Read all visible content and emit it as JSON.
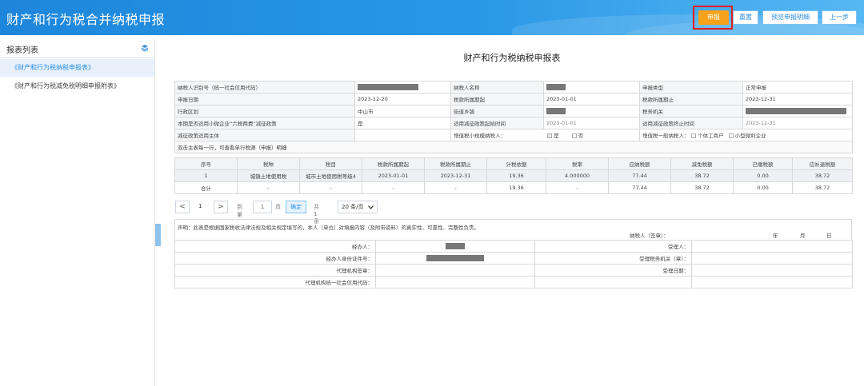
{
  "header": {
    "title": "财产和行为税合并纳税申报",
    "buttons": {
      "declare": "申报",
      "reset": "重置",
      "preview": "预览申报明细",
      "prev": "上一步"
    }
  },
  "sidebar": {
    "title": "报表列表",
    "items": [
      {
        "label": "《财产和行为税纳税申报表》"
      },
      {
        "label": "《财产和行为税减免税明细申报附表》"
      }
    ]
  },
  "form": {
    "title": "财产和行为税纳税申报表",
    "rows": [
      [
        "纳税人识别号（统一社会信用代码）",
        "",
        "纳税人名称",
        "",
        "申报类型",
        "正常申报"
      ],
      [
        "申报日期",
        "2023-12-20",
        "税款所属期起",
        "2023-01-01",
        "税款所属期止",
        "2023-12-31"
      ],
      [
        "行政区划",
        "中山市",
        "街道乡镇",
        "",
        "税务机关",
        ""
      ],
      [
        "本期是否适用小微企业“六税两费”减征政策",
        "是",
        "适用减征政策起始时间",
        "2023-01-01",
        "适用减征政策终止时间",
        "2023-12-31"
      ],
      [
        "减征政策适用主体",
        "",
        "增值税小规模纳税人：",
        "",
        "增值税一般纳税人：",
        ""
      ]
    ],
    "small_scale_options": [
      "是",
      "否"
    ],
    "general_options": [
      "个体工商户",
      "小型微利企业"
    ],
    "hint": "双击主表每一行，可查看单行税源（申报）明细"
  },
  "detail": {
    "headers": [
      "序号",
      "税种",
      "税目",
      "税款所属期起",
      "税款所属期止",
      "计税依据",
      "税率",
      "应纳税额",
      "减免税额",
      "已缴税额",
      "应补退税额"
    ],
    "rows": [
      [
        "1",
        "城镇土地使用税",
        "城市土地使用税等级4",
        "2023-01-01",
        "2023-12-31",
        "19.36",
        "4.000000",
        "77.44",
        "38.72",
        "0.00",
        "38.72"
      ],
      [
        "合计",
        "-",
        "-",
        "-",
        "-",
        "19.36",
        "-",
        "77.44",
        "38.72",
        "0.00",
        "38.72"
      ]
    ]
  },
  "pager": {
    "prev": "<",
    "page": "1",
    "next": ">",
    "goto_label": "到第",
    "goto_value": "1",
    "page_unit": "页",
    "confirm": "确定",
    "total": "共 1 条",
    "page_size": "20 条/页"
  },
  "declaration": {
    "text": "声明：此表是根据国家税收法律法规及相关规定填写的，本人（单位）对填报内容（及附带资料）的真实性、可靠性、完整性负责。",
    "signer": "纳税人（签章）：",
    "year": "年",
    "month": "月",
    "day": "日"
  },
  "signature_rows": [
    [
      "经办人：",
      "",
      "受理人：",
      ""
    ],
    [
      "经办人身份证件号：",
      "",
      "受理税务机关（章）：",
      ""
    ],
    [
      "代理机构签章：",
      "",
      "受理日期：",
      ""
    ],
    [
      "代理机构统一社会信用代码：",
      "",
      "",
      ""
    ]
  ],
  "colors": {
    "header_blue": "#2a97e6",
    "primary_button": "#f7a21b",
    "highlight_red": "#e01e1e"
  }
}
